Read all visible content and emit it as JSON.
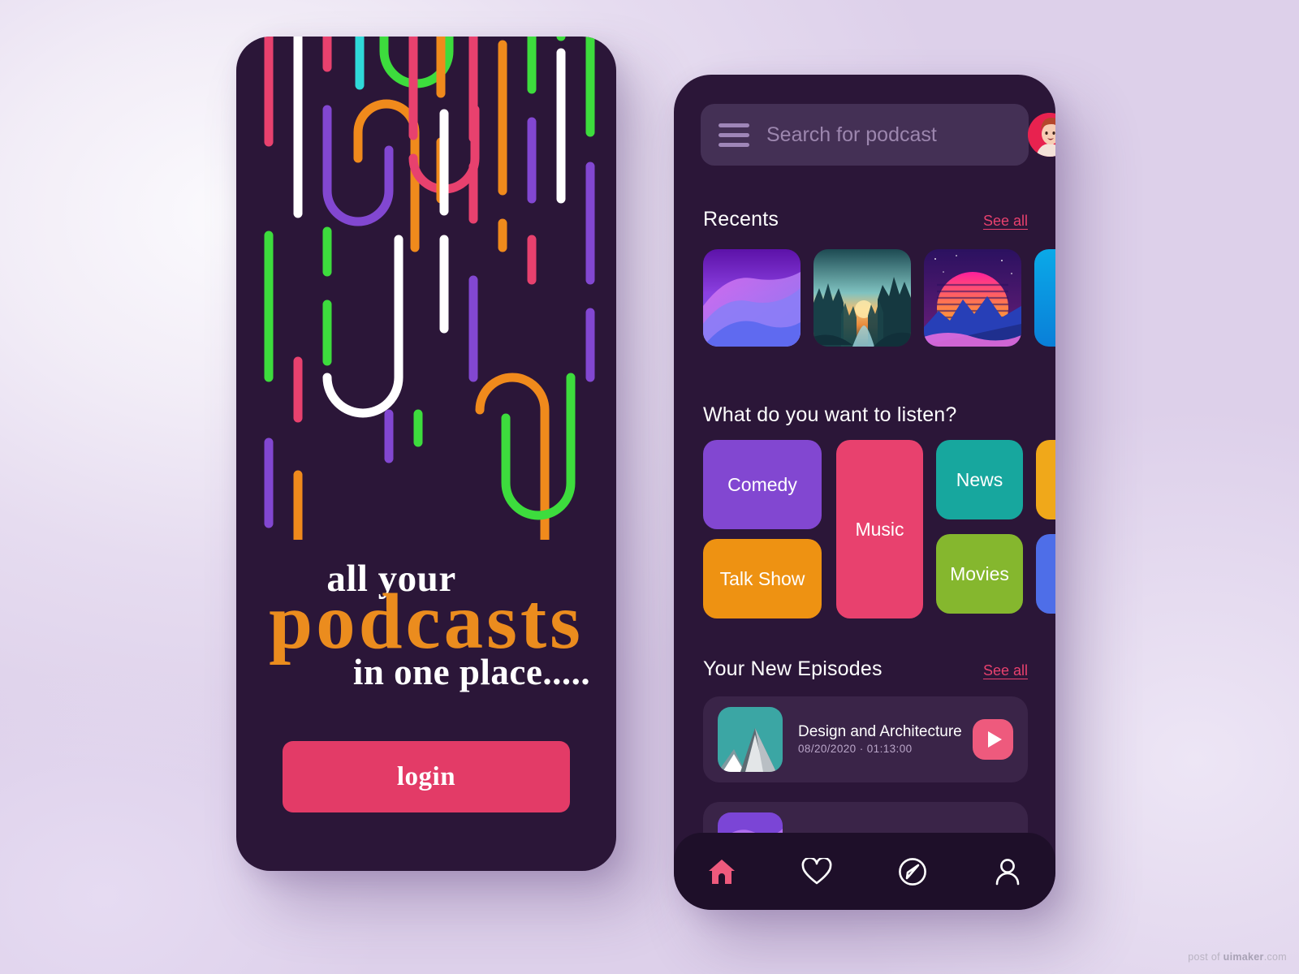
{
  "watermark": {
    "prefix": "post of ",
    "brand": "uimaker",
    "suffix": ".com"
  },
  "onboarding": {
    "hero_line1": "all your",
    "hero_line2": "podcasts",
    "hero_line3": "in one place.....",
    "login_label": "login",
    "accent_orange": "#eb8c1e",
    "accent_pink": "#e33b67",
    "background": "#2b1638",
    "pattern_colors": [
      "#3ddc3d",
      "#e8416e",
      "#ffffff",
      "#f08a1c",
      "#8247d1",
      "#2fd9d9"
    ]
  },
  "home": {
    "background": "#2b1638",
    "search": {
      "placeholder": "Search for podcast",
      "value": "",
      "menu_icon": "hamburger-menu-icon",
      "avatar_icon": "user-avatar"
    },
    "recents": {
      "title": "Recents",
      "see_all": "See all",
      "items": [
        {
          "art": "purple-dunes"
        },
        {
          "art": "forest-river-sunset"
        },
        {
          "art": "retrowave-mountain"
        },
        {
          "art": "blue-gradient"
        }
      ]
    },
    "categories": {
      "title": "What do you want to listen?",
      "items": [
        {
          "label": "Comedy",
          "color": "#8247d1"
        },
        {
          "label": "Talk Show",
          "color": "#ee9212"
        },
        {
          "label": "Music",
          "color": "#e8416e"
        },
        {
          "label": "News",
          "color": "#17a79e"
        },
        {
          "label": "Movies",
          "color": "#85b72e"
        },
        {
          "label": "",
          "color": "#f0a81a"
        },
        {
          "label": "",
          "color": "#4e6ee8"
        }
      ]
    },
    "episodes": {
      "title": "Your New Episodes",
      "see_all": "See all",
      "items": [
        {
          "title": "Design and Architecture",
          "meta": "08/20/2020 · 01:13:00",
          "art": "teal-mountain",
          "play_label": "play-icon"
        },
        {
          "title": "",
          "meta": "",
          "art": "purple-dunes",
          "play_label": "play-icon"
        }
      ]
    },
    "nav": [
      {
        "name": "home",
        "icon": "home-icon",
        "active": true
      },
      {
        "name": "favorites",
        "icon": "heart-icon",
        "active": false
      },
      {
        "name": "explore",
        "icon": "compass-icon",
        "active": false
      },
      {
        "name": "profile",
        "icon": "person-icon",
        "active": false
      }
    ],
    "nav_active_color": "#ee5a7d"
  }
}
